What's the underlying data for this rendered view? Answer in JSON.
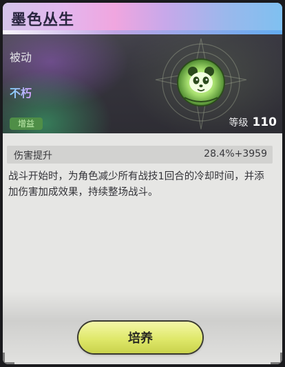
{
  "skill": {
    "name": "墨色丛生",
    "type": "被动",
    "keyword": "不朽",
    "tag": "增益",
    "level_label": "等级",
    "level_value": "110"
  },
  "stat": {
    "name": "伤害提升",
    "value": "28.4%+3959"
  },
  "description": "战斗开始时，为角色减少所有战技1回合的冷却时间，并添加伤害加成效果，持续整场战斗。",
  "actions": {
    "cultivate_label": "培养"
  },
  "colors": {
    "accent_button": "#dfe86a",
    "tag_badge": "#4f8e47",
    "emblem_glow": "#b8f27a"
  },
  "icons": {
    "emblem": "panda-emblem-icon"
  }
}
